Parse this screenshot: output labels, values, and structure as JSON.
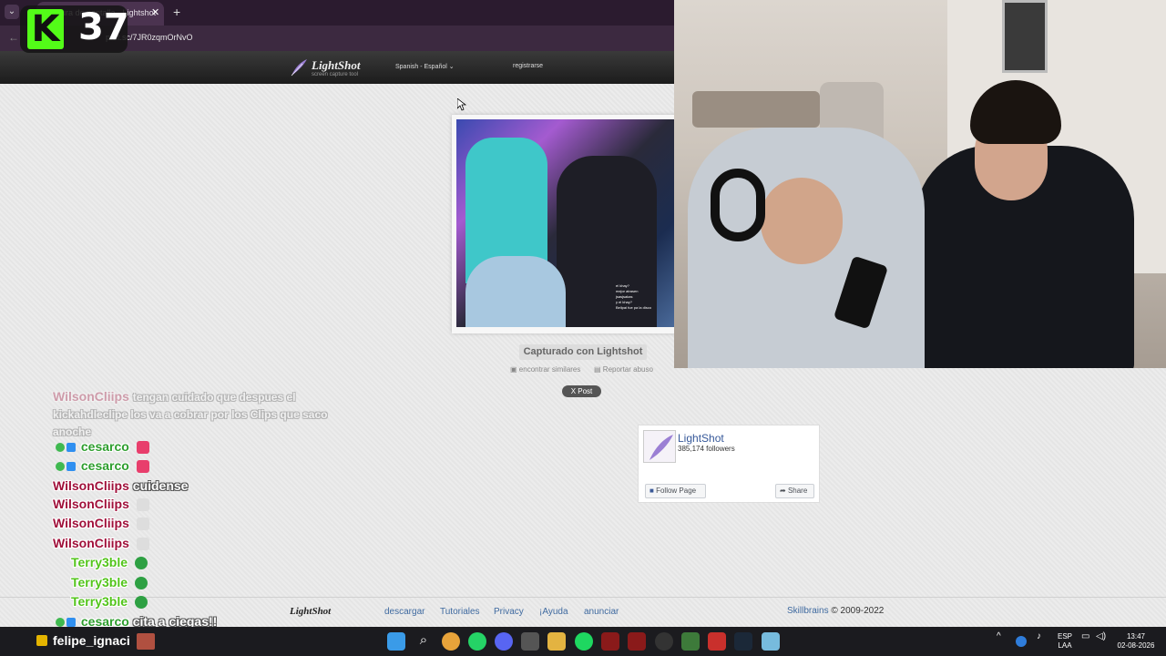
{
  "browser": {
    "tab_title": "Captura de pantalla - Lightshot",
    "url": "prnt.sc/7JR0zqmOrNvO"
  },
  "lightshot": {
    "logo": "LightShot",
    "logo_sub": "screen capture tool",
    "language": "Spanish - Español",
    "register": "registrarse",
    "captured_label": "Capturado con Lightshot",
    "similar_label": "encontrar similares",
    "report_label": "Reportar abuso",
    "post_label": "X Post",
    "screenshot_chat": [
      "el khay?",
      "mejor atrasen",
      "jsasjsakas",
      "y el khay?",
      "Bellpai fue pa la disco"
    ]
  },
  "facebook": {
    "name": "LightShot",
    "followers": "385,174 followers",
    "follow_label": "Follow Page",
    "share_label": "Share"
  },
  "footer": {
    "logo": "LightShot",
    "links": [
      "descargar",
      "Tutoriales",
      "Privacy",
      "¡Ayuda",
      "anunciar"
    ],
    "copyright_brand": "Skillbrains",
    "copyright_years": "© 2009-2022"
  },
  "overlay": {
    "kick_letter": "K",
    "kick_count": "37"
  },
  "chat": [
    {
      "user": "WilsonCliips",
      "msg": "tengan cuidado que despues el kickahdleclipe los va a cobrar por los Clips que saco anoche",
      "faded": true
    },
    {
      "user": "cesarco",
      "msg": "",
      "badges": true
    },
    {
      "user": "cesarco",
      "msg": "",
      "badges": true
    },
    {
      "user": "WilsonCliips",
      "msg": "cuidense"
    },
    {
      "user": "WilsonCliips",
      "msg": ""
    },
    {
      "user": "WilsonCliips",
      "msg": ""
    },
    {
      "user": "WilsonCliips",
      "msg": ""
    },
    {
      "user": "Terry3ble",
      "msg": ""
    },
    {
      "user": "Terry3ble",
      "msg": ""
    },
    {
      "user": "Terry3ble",
      "msg": ""
    },
    {
      "user": "cesarco",
      "msg": "cita a ciegas!!",
      "badges": true
    }
  ],
  "taskbar": {
    "streamer": "felipe_ignaci",
    "lang_top": "ESP",
    "lang_bottom": "LAA",
    "time": "13:47",
    "date": "02-08-2026"
  },
  "colors": {
    "wilson": "#a0103a",
    "cesarco": "#2e9e2e",
    "terry": "#52c41a",
    "kick_green": "#53fc18"
  }
}
